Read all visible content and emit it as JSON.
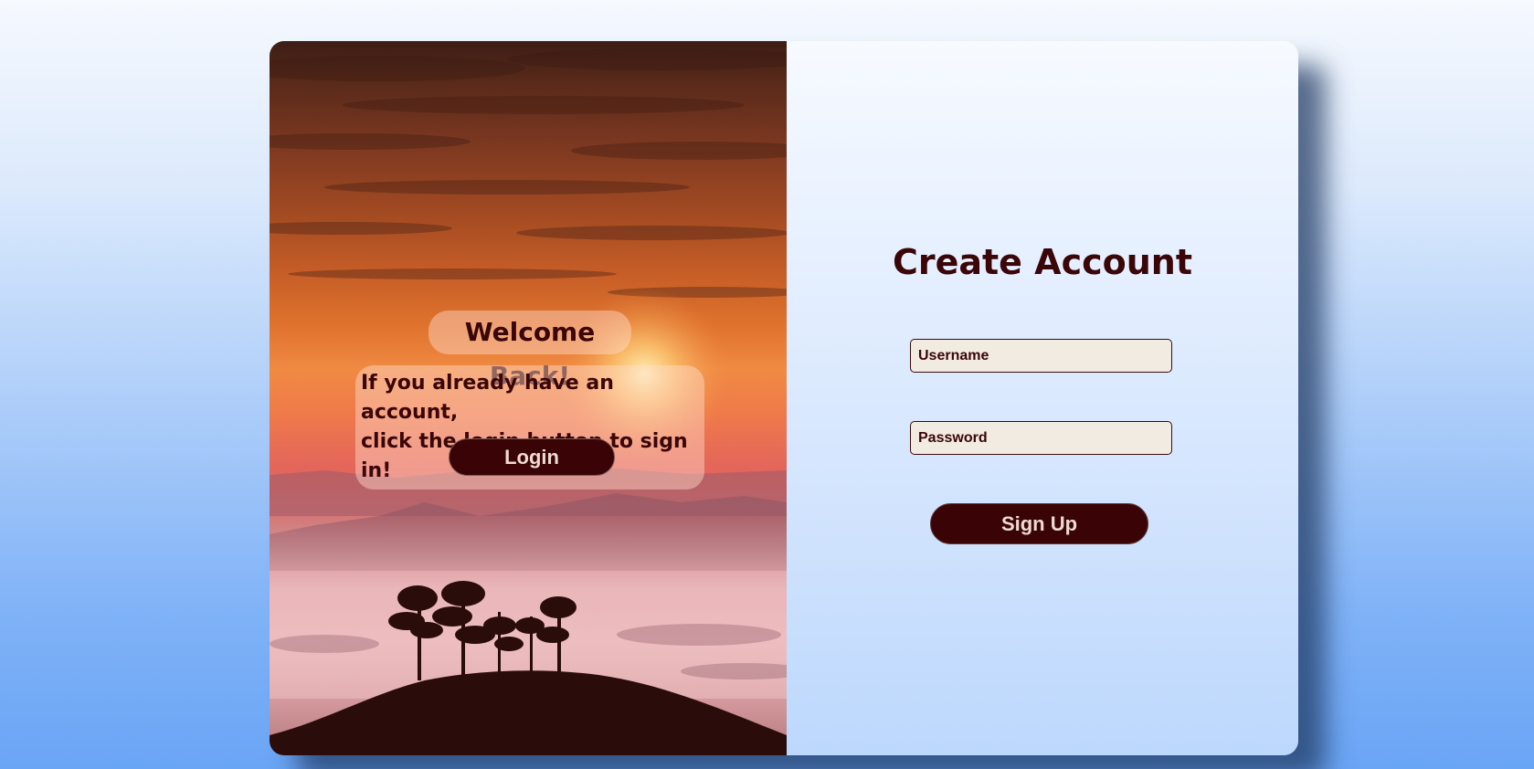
{
  "login_panel": {
    "title": "Welcome Back!",
    "message_line_1": "If you already have an account,",
    "message_line_2": "click the login button to sign in!",
    "login_label": "Login",
    "background_image": "sunset-landscape-trees-on-hill"
  },
  "signup_panel": {
    "title": "Create Account",
    "username_placeholder": "Username",
    "username_value": "",
    "password_placeholder": "Password",
    "password_value": "",
    "signup_label": "Sign Up"
  },
  "colors": {
    "accent_dark": "#3a0406",
    "text_dark": "#3a0608",
    "button_text": "#eddad0",
    "input_background": "#f1ebe2"
  }
}
